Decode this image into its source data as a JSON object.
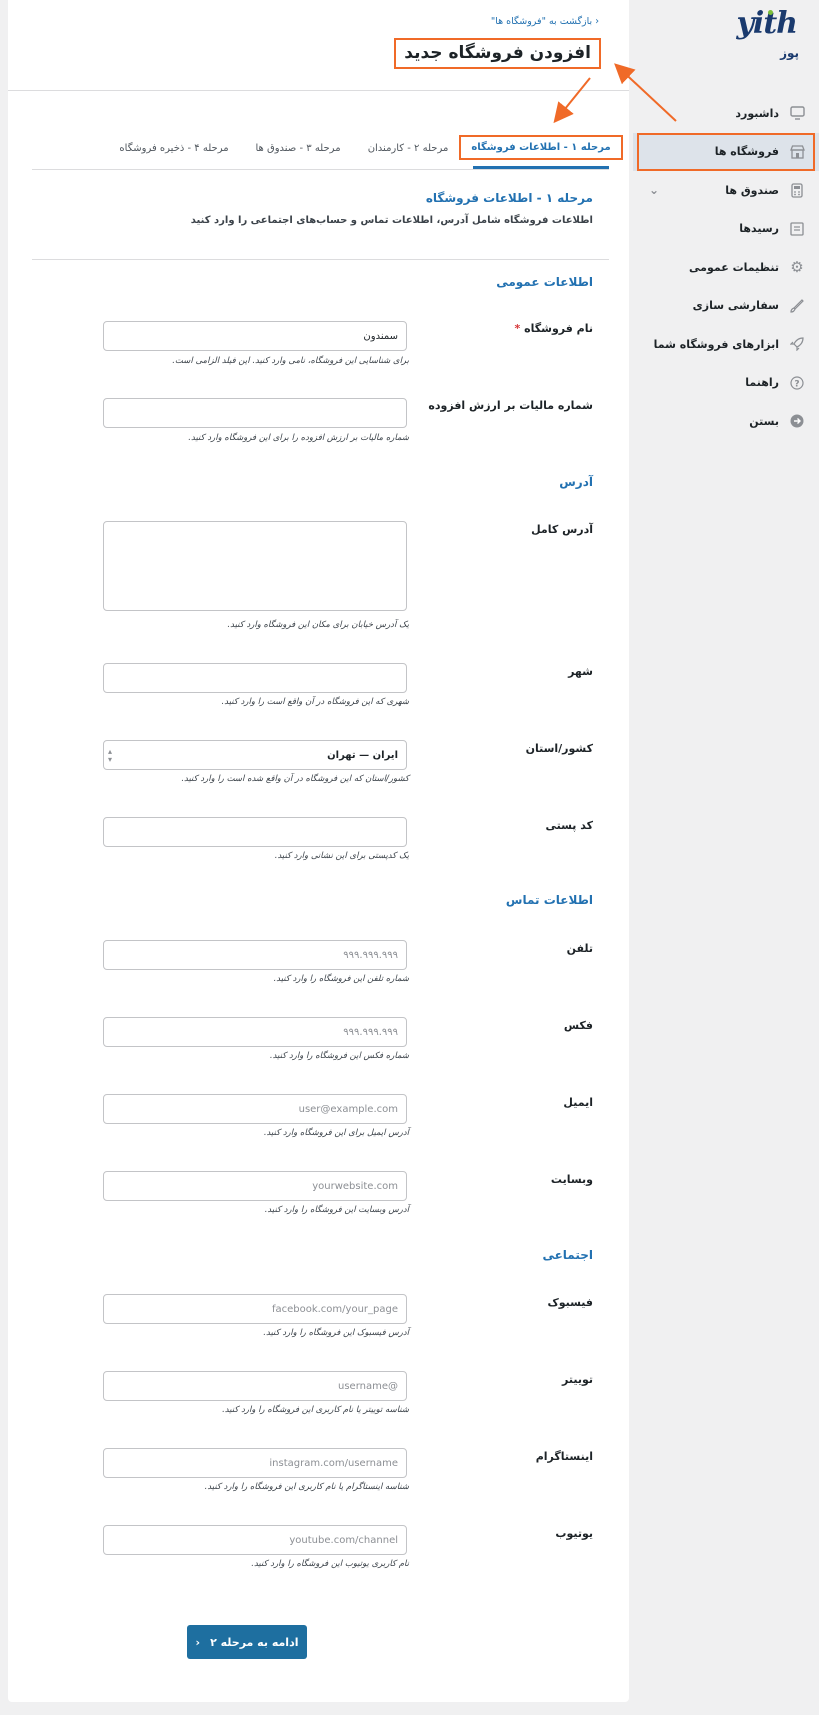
{
  "sidebar": {
    "logo": "yith",
    "app_name": "پوز",
    "items": [
      {
        "label": "داشبورد",
        "icon": "monitor-icon"
      },
      {
        "label": "فروشگاه ها",
        "icon": "store-icon"
      },
      {
        "label": "صندوق ها",
        "icon": "register-icon"
      },
      {
        "label": "رسیدها",
        "icon": "receipt-icon"
      },
      {
        "label": "تنظیمات عمومی",
        "icon": "gear-icon"
      },
      {
        "label": "سفارشی سازی",
        "icon": "brush-icon"
      },
      {
        "label": "ابزارهای فروشگاه شما",
        "icon": "rocket-icon"
      },
      {
        "label": "راهنما",
        "icon": "help-icon"
      },
      {
        "label": "بستن",
        "icon": "close-arrow-icon"
      }
    ]
  },
  "header": {
    "back_link": "بازگشت به \"فروشگاه ها\"",
    "title": "افزودن فروشگاه جدید"
  },
  "tabs": [
    "مرحله ۱ - اطلاعات فروشگاه",
    "مرحله ۲ - کارمندان",
    "مرحله ۳ - صندوق ها",
    "مرحله ۴ - ذخیره فروشگاه"
  ],
  "step": {
    "title": "مرحله ۱ - اطلاعات فروشگاه",
    "description": "اطلاعات فروشگاه شامل آدرس، اطلاعات تماس و حساب‌های اجتماعی را وارد کنید"
  },
  "sections": {
    "general": "اطلاعات عمومی",
    "address": "آدرس",
    "contact": "اطلاعات تماس",
    "social": "اجتماعی"
  },
  "fields": {
    "store_name": {
      "label": "نام فروشگاه",
      "required_mark": "*",
      "value": "سمندون",
      "help": "برای شناسایی این فروشگاه، نامی وارد کنید.  این فیلد الزامی است."
    },
    "vat": {
      "label": "شماره مالیات بر ارزش افزوده",
      "help": "شماره مالیات بر ارزش افزوده را برای این فروشگاه وارد کنید."
    },
    "full_address": {
      "label": "آدرس کامل",
      "help": "یک آدرس خیابان برای مکان این فروشگاه وارد کنید."
    },
    "city": {
      "label": "شهر",
      "help": "شهری که این فروشگاه در آن واقع است را وارد کنید."
    },
    "country": {
      "label": "کشور/استان",
      "value": "ایران — تهران",
      "help": "کشور/استان که این فروشگاه در آن واقع شده است را وارد کنید."
    },
    "postcode": {
      "label": "کد پستی",
      "help": "یک کدپستی برای این نشانی وارد کنید."
    },
    "phone": {
      "label": "تلفن",
      "placeholder": "۹۹۹.۹۹۹.۹۹۹",
      "help": "شماره تلفن این فروشگاه را وارد کنید."
    },
    "fax": {
      "label": "فکس",
      "placeholder": "۹۹۹.۹۹۹.۹۹۹",
      "help": "شماره فکس این فروشگاه را وارد کنید."
    },
    "email": {
      "label": "ایمیل",
      "placeholder": "user@example.com",
      "help": "آدرس ایمیل برای این فروشگاه وارد کنید."
    },
    "website": {
      "label": "وبسایت",
      "placeholder": "yourwebsite.com",
      "help": "آدرس وبسایت این فروشگاه را وارد کنید."
    },
    "facebook": {
      "label": "فیسبوک",
      "placeholder": "facebook.com/your_page",
      "help": "آدرس فیسبوک این فروشگاه را وارد کنید."
    },
    "twitter": {
      "label": "توییتر",
      "placeholder": "@username",
      "help": "شناسه توییتر یا نام کاربری این فروشگاه را وارد کنید."
    },
    "instagram": {
      "label": "اینستاگرام",
      "placeholder": "instagram.com/username",
      "help": "شناسه اینستاگرام یا نام کاربری این فروشگاه را وارد کنید."
    },
    "youtube": {
      "label": "یوتیوب",
      "placeholder": "youtube.com/channel",
      "help": "نام کاربری یوتیوب این فروشگاه را وارد کنید."
    }
  },
  "next_button": "ادامه به مرحله ۲",
  "colors": {
    "accent": "#2271b1",
    "annotation": "#f06a28",
    "button": "#1e6fa0"
  }
}
